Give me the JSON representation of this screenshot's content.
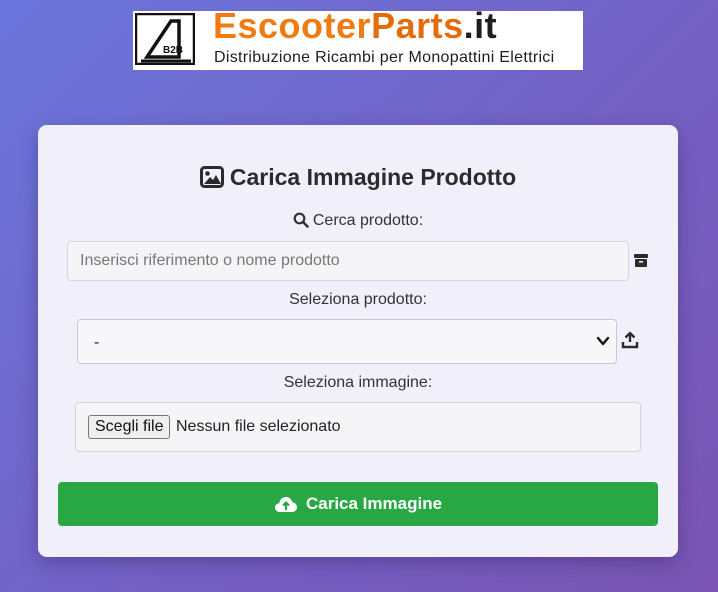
{
  "logo": {
    "badge": "B2B",
    "title_part1": "Escooter",
    "title_part2": "Parts",
    "title_part3": ".it",
    "subtitle": "Distribuzione Ricambi per Monopattini Elettrici"
  },
  "form": {
    "title": "Carica Immagine Prodotto",
    "title_icon": "image-icon",
    "search_label": "Cerca prodotto:",
    "search_icon": "search-icon",
    "search_placeholder": "Inserisci riferimento o nome prodotto",
    "search_value": "",
    "search_side_icon": "box-icon",
    "select_label": "Seleziona prodotto:",
    "select_value": "-",
    "select_side_icon": "upload-icon",
    "image_label": "Seleziona immagine:",
    "file_button_label": "Scegli file",
    "file_status": "Nessun file selezionato",
    "submit_label": "Carica Immagine",
    "submit_icon": "cloud-upload-icon"
  },
  "colors": {
    "background_start": "#6b76dc",
    "background_end": "#7a55b3",
    "card": "#f0effa",
    "submit": "#28a745",
    "brand_orange": "#f07b12"
  }
}
